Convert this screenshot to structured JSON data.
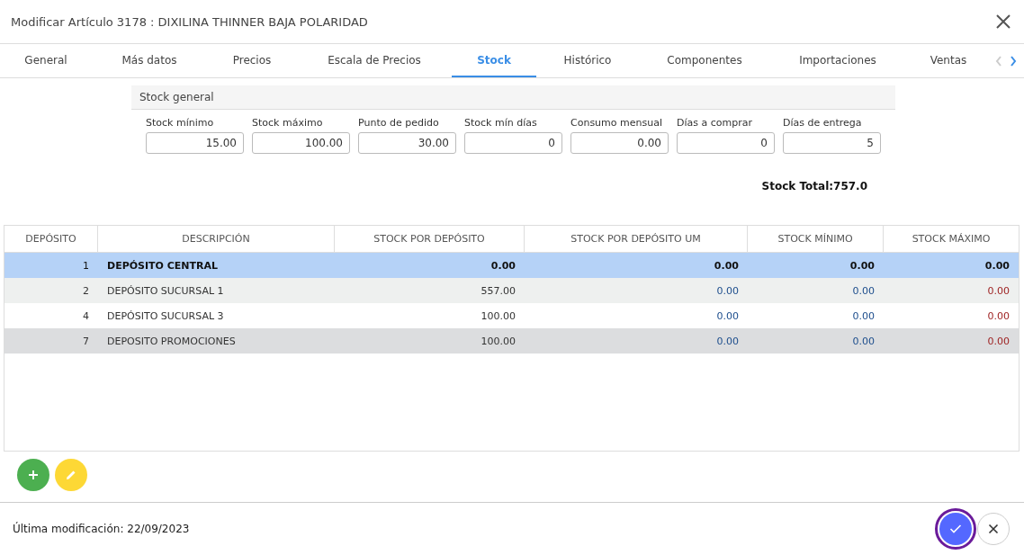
{
  "dialog": {
    "title": "Modificar Artículo 3178 : DIXILINA THINNER BAJA POLARIDAD"
  },
  "tabs": [
    {
      "label": "General",
      "selected": false
    },
    {
      "label": "Más datos",
      "selected": false
    },
    {
      "label": "Precios",
      "selected": false
    },
    {
      "label": "Escala de Precios",
      "selected": false
    },
    {
      "label": "Stock",
      "selected": true
    },
    {
      "label": "Histórico",
      "selected": false
    },
    {
      "label": "Componentes",
      "selected": false
    },
    {
      "label": "Importaciones",
      "selected": false
    },
    {
      "label": "Ventas",
      "selected": false
    }
  ],
  "tab_scroll": {
    "left_disabled": true,
    "right_disabled": false
  },
  "stock_general": {
    "title": "Stock general",
    "fields": [
      {
        "label": "Stock mínimo",
        "value": "15.00"
      },
      {
        "label": "Stock máximo",
        "value": "100.00"
      },
      {
        "label": "Punto de pedido",
        "value": "30.00"
      },
      {
        "label": "Stock mín días",
        "value": "0"
      },
      {
        "label": "Consumo mensual",
        "value": "0.00"
      },
      {
        "label": "Días a comprar",
        "value": "0"
      },
      {
        "label": "Días de entrega",
        "value": "5"
      }
    ],
    "total": "Stock Total:757.0"
  },
  "table": {
    "columns": [
      "DEPÓSITO",
      "DESCRIPCIÓN",
      "STOCK POR DEPÓSITO",
      "STOCK POR DEPÓSITO UM",
      "STOCK MÍNIMO",
      "STOCK MÁXIMO"
    ],
    "rows": [
      {
        "cells": [
          "1",
          "DEPÓSITO CENTRAL",
          "0.00",
          "0.00",
          "0.00",
          "0.00"
        ],
        "selected": true,
        "highlighted": false
      },
      {
        "cells": [
          "2",
          "DEPÓSITO SUCURSAL 1",
          "557.00",
          "0.00",
          "0.00",
          "0.00"
        ],
        "selected": false,
        "highlighted": false
      },
      {
        "cells": [
          "4",
          "DEPÓSITO SUCURSAL 3",
          "100.00",
          "0.00",
          "0.00",
          "0.00"
        ],
        "selected": false,
        "highlighted": false
      },
      {
        "cells": [
          "7",
          "DEPOSITO PROMOCIONES",
          "100.00",
          "0.00",
          "0.00",
          "0.00"
        ],
        "selected": false,
        "highlighted": true
      }
    ]
  },
  "footer": {
    "last_modified": "Última modificación: 22/09/2023"
  }
}
